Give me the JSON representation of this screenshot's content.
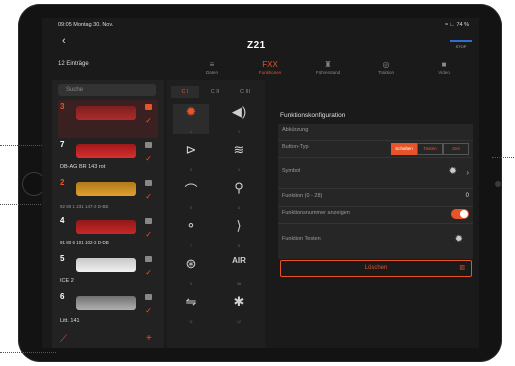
{
  "statusbar": {
    "time": "09:05 Montag 30. Nov.",
    "battery": "≈ ∟ 74 %"
  },
  "app": {
    "title": "Z21",
    "back": "‹",
    "stop_label": "STOP"
  },
  "list": {
    "count": "12 Einträge",
    "search_placeholder": "Suche",
    "items": [
      {
        "num": "3",
        "name": ""
      },
      {
        "num": "7",
        "name": "DB-AG BR 143 rot"
      },
      {
        "num": "2",
        "name": "92 80 1 231 147-2 D-BE"
      },
      {
        "num": "4",
        "name": "91 80 6 101 102-2 D-DB"
      },
      {
        "num": "5",
        "name": "ICE 2"
      },
      {
        "num": "6",
        "name": "Litt. 141"
      }
    ]
  },
  "tabs": [
    {
      "label": "Daten",
      "icon": "≡"
    },
    {
      "label": "Funktionen",
      "icon": "FXX"
    },
    {
      "label": "Führerstand",
      "icon": "♜"
    },
    {
      "label": "Traktion",
      "icon": "◎"
    },
    {
      "label": "Video",
      "icon": "■"
    }
  ],
  "func_tabs": [
    "C I",
    "C II",
    "C III"
  ],
  "functions": [
    {
      "icon": "✹",
      "num": "1"
    },
    {
      "icon": "◀)",
      "num": "2"
    },
    {
      "icon": "⊳",
      "num": "3"
    },
    {
      "icon": "≋",
      "num": "4"
    },
    {
      "icon": "⌒",
      "num": "5"
    },
    {
      "icon": "⚲",
      "num": "6"
    },
    {
      "icon": "⚬",
      "num": "7"
    },
    {
      "icon": "⟩",
      "num": "8"
    },
    {
      "icon": "⊛",
      "num": "9"
    },
    {
      "icon": "AIR",
      "num": "10"
    },
    {
      "icon": "⇋",
      "num": "11"
    },
    {
      "icon": "✱",
      "num": "12"
    }
  ],
  "config": {
    "title": "Funktionskonfiguration",
    "abbr_label": "Abkürzung",
    "button_type_label": "Button-Typ",
    "button_types": [
      "Schalten",
      "Tasten",
      "Zeit"
    ],
    "symbol_label": "Symbol",
    "function_label": "Funktion (0 - 28)",
    "function_value": "0",
    "show_number_label": "Funktionsnummer anzeigen",
    "test_label": "Funktion Testen",
    "delete_label": "Löschen"
  },
  "colors": {
    "accent": "#e8542a",
    "stop_blue": "#2d6fd1"
  }
}
